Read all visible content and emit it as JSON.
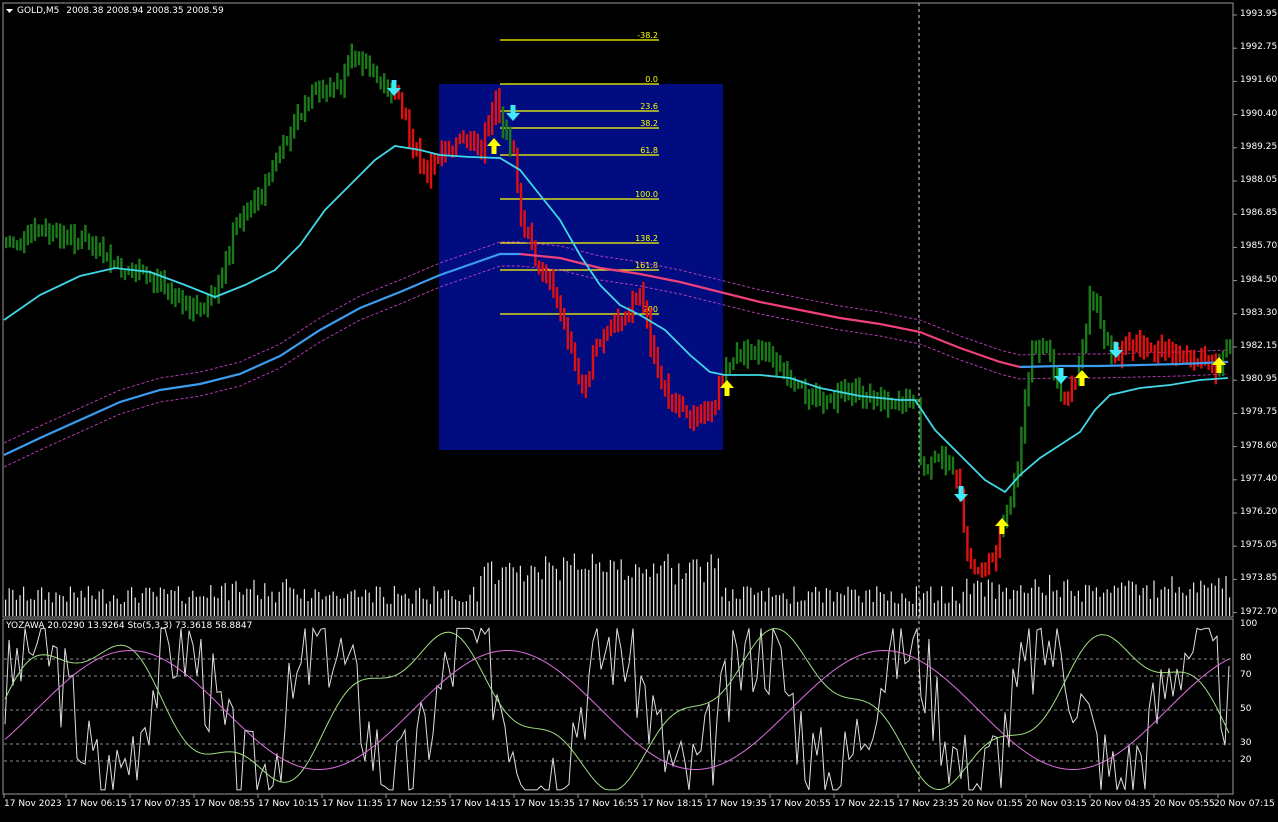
{
  "chart_header": {
    "symbol": "GOLD,M5",
    "ohlc": "2008.38 2008.94 2008.35 2008.59"
  },
  "indicator_header": {
    "text": "YOZAWA 20.0290 13.9264  Sto(5,3,3) 73.3618 58.8847"
  },
  "price_axis": [
    "1993.95",
    "1992.75",
    "1991.60",
    "1990.40",
    "1989.25",
    "1988.05",
    "1986.85",
    "1985.70",
    "1984.50",
    "1983.30",
    "1982.15",
    "1980.95",
    "1979.75",
    "1978.60",
    "1977.40",
    "1976.20",
    "1975.05",
    "1973.85",
    "1972.70"
  ],
  "osc_axis": [
    "100",
    "80",
    "70",
    "50",
    "30",
    "20"
  ],
  "time_axis": [
    "17 Nov 2023",
    "17 Nov 06:15",
    "17 Nov 07:35",
    "17 Nov 08:55",
    "17 Nov 10:15",
    "17 Nov 11:35",
    "17 Nov 12:55",
    "17 Nov 14:15",
    "17 Nov 15:35",
    "17 Nov 16:55",
    "17 Nov 18:15",
    "17 Nov 19:35",
    "17 Nov 20:55",
    "17 Nov 22:15",
    "17 Nov 23:35",
    "20 Nov 01:55",
    "20 Nov 03:15",
    "20 Nov 04:35",
    "20 Nov 05:55",
    "20 Nov 07:15"
  ],
  "fibo_levels": [
    "-38.2",
    "0.0",
    "23.6",
    "38.2",
    "61.8",
    "100.0",
    "138.2",
    "161.8",
    "200"
  ],
  "colors": {
    "bull": "#1a7a1a",
    "bear": "#e01010",
    "ma_fast": "#40d8e8",
    "ma_slow": "#3c9cf0",
    "ma_slow_bear": "#f0407a",
    "band": "#c040c0",
    "fibo": "#ffff00",
    "rect": "#000c80",
    "arrow_up": "#ffff00",
    "arrow_down": "#40e8f8",
    "osc_white": "#e0e0e0",
    "osc_green": "#a0e080",
    "osc_pink": "#e070e0",
    "grid": "#c8c8c8"
  }
}
